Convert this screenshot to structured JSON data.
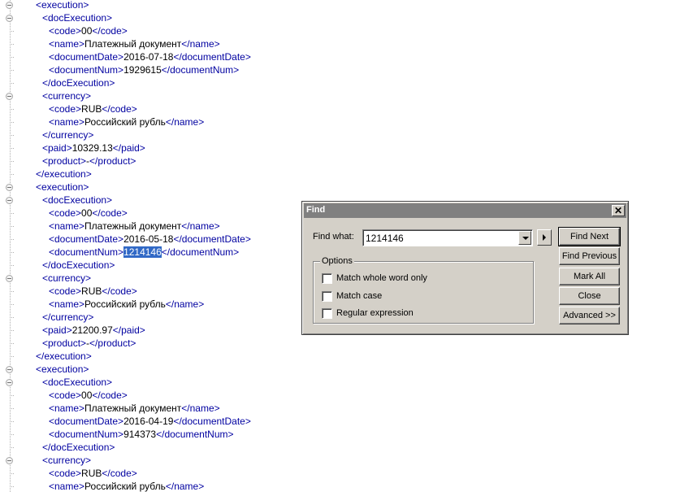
{
  "editor": {
    "lines": [
      {
        "fold": true,
        "parts": [
          [
            "tag",
            "<execution>"
          ]
        ]
      },
      {
        "fold": true,
        "parts": [
          [
            "tag",
            "<docExecution>"
          ]
        ]
      },
      {
        "fold": false,
        "parts": [
          [
            "tag",
            "<code>"
          ],
          [
            "text",
            "00"
          ],
          [
            "tag",
            "</code>"
          ]
        ]
      },
      {
        "fold": false,
        "parts": [
          [
            "tag",
            "<name>"
          ],
          [
            "text",
            "Платежный документ"
          ],
          [
            "tag",
            "</name>"
          ]
        ]
      },
      {
        "fold": false,
        "parts": [
          [
            "tag",
            "<documentDate>"
          ],
          [
            "text",
            "2016-07-18"
          ],
          [
            "tag",
            "</documentDate>"
          ]
        ]
      },
      {
        "fold": false,
        "parts": [
          [
            "tag",
            "<documentNum>"
          ],
          [
            "text",
            "1929615"
          ],
          [
            "tag",
            "</documentNum>"
          ]
        ]
      },
      {
        "fold": false,
        "parts": [
          [
            "tag",
            "</docExecution>"
          ]
        ]
      },
      {
        "fold": true,
        "parts": [
          [
            "tag",
            "<currency>"
          ]
        ]
      },
      {
        "fold": false,
        "parts": [
          [
            "tag",
            "<code>"
          ],
          [
            "text",
            "RUB"
          ],
          [
            "tag",
            "</code>"
          ]
        ]
      },
      {
        "fold": false,
        "parts": [
          [
            "tag",
            "<name>"
          ],
          [
            "text",
            "Российский рубль"
          ],
          [
            "tag",
            "</name>"
          ]
        ]
      },
      {
        "fold": false,
        "parts": [
          [
            "tag",
            "</currency>"
          ]
        ]
      },
      {
        "fold": false,
        "parts": [
          [
            "tag",
            "<paid>"
          ],
          [
            "text",
            "10329.13"
          ],
          [
            "tag",
            "</paid>"
          ]
        ]
      },
      {
        "fold": false,
        "parts": [
          [
            "tag",
            "<product>"
          ],
          [
            "text",
            "-"
          ],
          [
            "tag",
            "</product>"
          ]
        ]
      },
      {
        "fold": false,
        "parts": [
          [
            "tag",
            "</execution>"
          ]
        ]
      },
      {
        "fold": true,
        "parts": [
          [
            "tag",
            "<execution>"
          ]
        ]
      },
      {
        "fold": true,
        "parts": [
          [
            "tag",
            "<docExecution>"
          ]
        ]
      },
      {
        "fold": false,
        "parts": [
          [
            "tag",
            "<code>"
          ],
          [
            "text",
            "00"
          ],
          [
            "tag",
            "</code>"
          ]
        ]
      },
      {
        "fold": false,
        "parts": [
          [
            "tag",
            "<name>"
          ],
          [
            "text",
            "Платежный документ"
          ],
          [
            "tag",
            "</name>"
          ]
        ]
      },
      {
        "fold": false,
        "parts": [
          [
            "tag",
            "<documentDate>"
          ],
          [
            "text",
            "2016-05-18"
          ],
          [
            "tag",
            "</documentDate>"
          ]
        ]
      },
      {
        "fold": false,
        "parts": [
          [
            "tag",
            "<documentNum>"
          ],
          [
            "sel",
            "1214146"
          ],
          [
            "tag",
            "</documentNum>"
          ]
        ]
      },
      {
        "fold": false,
        "parts": [
          [
            "tag",
            "</docExecution>"
          ]
        ]
      },
      {
        "fold": true,
        "parts": [
          [
            "tag",
            "<currency>"
          ]
        ]
      },
      {
        "fold": false,
        "parts": [
          [
            "tag",
            "<code>"
          ],
          [
            "text",
            "RUB"
          ],
          [
            "tag",
            "</code>"
          ]
        ]
      },
      {
        "fold": false,
        "parts": [
          [
            "tag",
            "<name>"
          ],
          [
            "text",
            "Российский рубль"
          ],
          [
            "tag",
            "</name>"
          ]
        ]
      },
      {
        "fold": false,
        "parts": [
          [
            "tag",
            "</currency>"
          ]
        ]
      },
      {
        "fold": false,
        "parts": [
          [
            "tag",
            "<paid>"
          ],
          [
            "text",
            "21200.97"
          ],
          [
            "tag",
            "</paid>"
          ]
        ]
      },
      {
        "fold": false,
        "parts": [
          [
            "tag",
            "<product>"
          ],
          [
            "text",
            "-"
          ],
          [
            "tag",
            "</product>"
          ]
        ]
      },
      {
        "fold": false,
        "parts": [
          [
            "tag",
            "</execution>"
          ]
        ]
      },
      {
        "fold": true,
        "parts": [
          [
            "tag",
            "<execution>"
          ]
        ]
      },
      {
        "fold": true,
        "parts": [
          [
            "tag",
            "<docExecution>"
          ]
        ]
      },
      {
        "fold": false,
        "parts": [
          [
            "tag",
            "<code>"
          ],
          [
            "text",
            "00"
          ],
          [
            "tag",
            "</code>"
          ]
        ]
      },
      {
        "fold": false,
        "parts": [
          [
            "tag",
            "<name>"
          ],
          [
            "text",
            "Платежный документ"
          ],
          [
            "tag",
            "</name>"
          ]
        ]
      },
      {
        "fold": false,
        "parts": [
          [
            "tag",
            "<documentDate>"
          ],
          [
            "text",
            "2016-04-19"
          ],
          [
            "tag",
            "</documentDate>"
          ]
        ]
      },
      {
        "fold": false,
        "parts": [
          [
            "tag",
            "<documentNum>"
          ],
          [
            "text",
            "914373"
          ],
          [
            "tag",
            "</documentNum>"
          ]
        ]
      },
      {
        "fold": false,
        "parts": [
          [
            "tag",
            "</docExecution>"
          ]
        ]
      },
      {
        "fold": true,
        "parts": [
          [
            "tag",
            "<currency>"
          ]
        ]
      },
      {
        "fold": false,
        "parts": [
          [
            "tag",
            "<code>"
          ],
          [
            "text",
            "RUB"
          ],
          [
            "tag",
            "</code>"
          ]
        ]
      },
      {
        "fold": false,
        "parts": [
          [
            "tag",
            "<name>"
          ],
          [
            "text",
            "Российский рубль"
          ],
          [
            "tag",
            "</name>"
          ]
        ]
      }
    ],
    "colors": {
      "tag": "#0000a0",
      "text": "#000000",
      "selection": "#3169c6"
    }
  },
  "find_dialog": {
    "title": "Find",
    "close_glyph": "✕",
    "find_what_label": "Find what:",
    "find_what_value": "1214146",
    "options_legend": "Options",
    "options": [
      {
        "label": "Match whole word only",
        "checked": false
      },
      {
        "label": "Match case",
        "checked": false
      },
      {
        "label": "Regular expression",
        "checked": false
      }
    ],
    "buttons": {
      "find_next": "Find Next",
      "find_previous": "Find Previous",
      "mark_all": "Mark All",
      "close": "Close",
      "advanced": "Advanced >>"
    }
  }
}
